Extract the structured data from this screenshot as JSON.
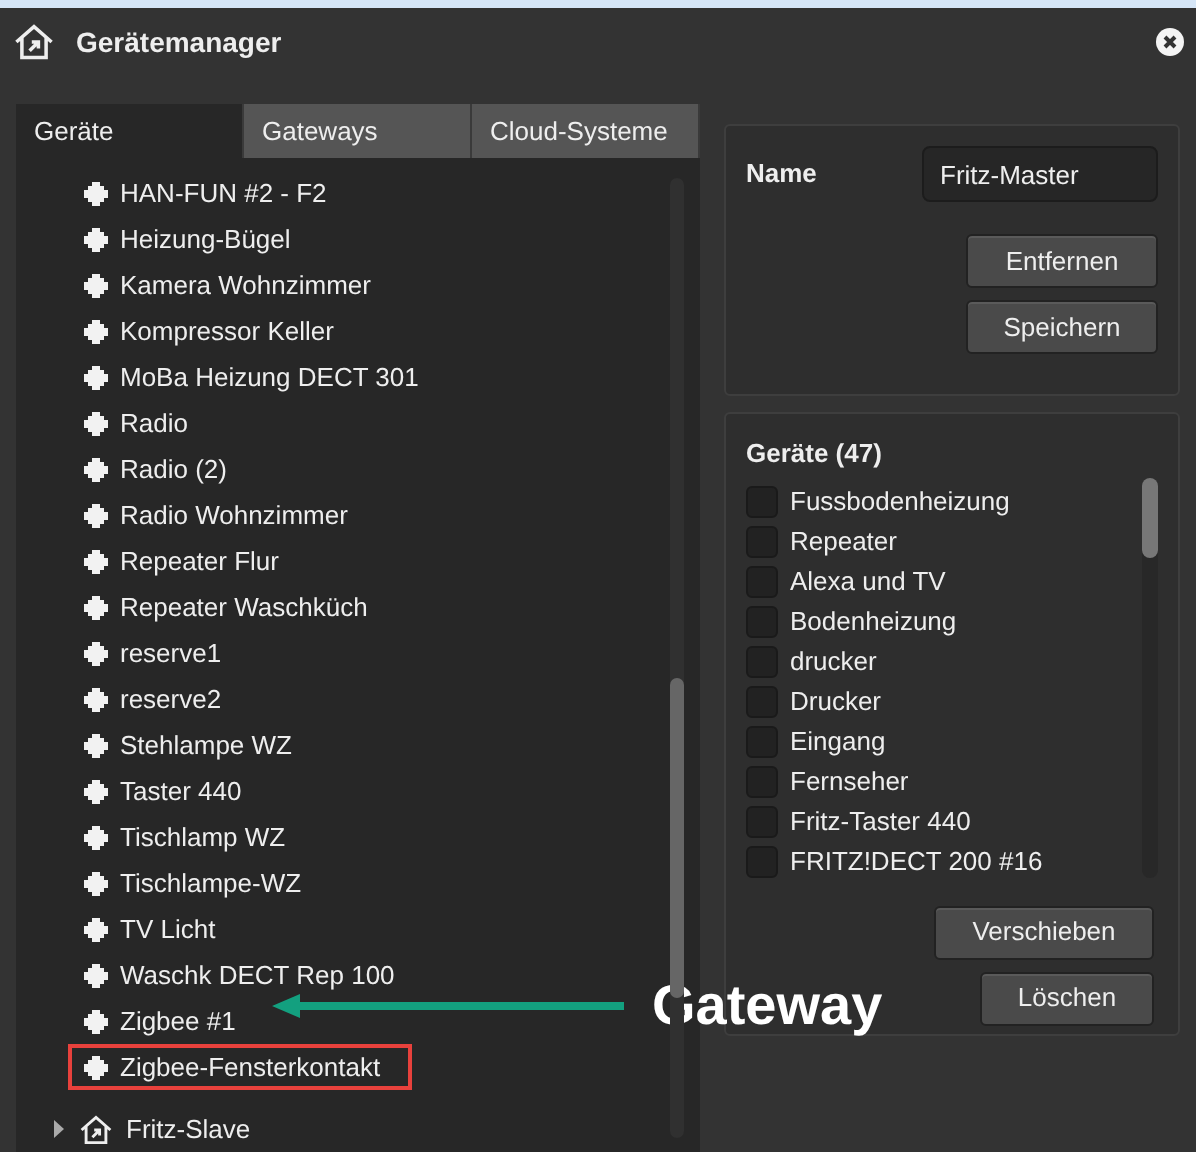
{
  "window": {
    "title": "Gerätemanager"
  },
  "tabs": [
    {
      "label": "Geräte",
      "selected": true
    },
    {
      "label": "Gateways",
      "selected": false
    },
    {
      "label": "Cloud-Systeme",
      "selected": false
    }
  ],
  "tree": [
    {
      "kind": "device",
      "label": "HAN-FUN #2 - F2",
      "highlighted": false
    },
    {
      "kind": "device",
      "label": "Heizung-Bügel",
      "highlighted": false
    },
    {
      "kind": "device",
      "label": "Kamera Wohnzimmer",
      "highlighted": false
    },
    {
      "kind": "device",
      "label": "Kompressor Keller",
      "highlighted": false
    },
    {
      "kind": "device",
      "label": "MoBa Heizung DECT 301",
      "highlighted": false
    },
    {
      "kind": "device",
      "label": "Radio",
      "highlighted": false
    },
    {
      "kind": "device",
      "label": "Radio (2)",
      "highlighted": false
    },
    {
      "kind": "device",
      "label": "Radio Wohnzimmer",
      "highlighted": false
    },
    {
      "kind": "device",
      "label": "Repeater Flur",
      "highlighted": false
    },
    {
      "kind": "device",
      "label": "Repeater Waschküch",
      "highlighted": false
    },
    {
      "kind": "device",
      "label": "reserve1",
      "highlighted": false
    },
    {
      "kind": "device",
      "label": "reserve2",
      "highlighted": false
    },
    {
      "kind": "device",
      "label": "Stehlampe WZ",
      "highlighted": false
    },
    {
      "kind": "device",
      "label": "Taster 440",
      "highlighted": false
    },
    {
      "kind": "device",
      "label": "Tischlamp WZ",
      "highlighted": false
    },
    {
      "kind": "device",
      "label": "Tischlampe-WZ",
      "highlighted": false
    },
    {
      "kind": "device",
      "label": "TV Licht",
      "highlighted": false
    },
    {
      "kind": "device",
      "label": "Waschk DECT Rep 100",
      "highlighted": false
    },
    {
      "kind": "device",
      "label": "Zigbee #1",
      "highlighted": false,
      "callout": "Gateway"
    },
    {
      "kind": "device",
      "label": "Zigbee-Fensterkontakt",
      "highlighted": true
    },
    {
      "kind": "gateway",
      "label": "Fritz-Slave",
      "highlighted": false,
      "expanded": false
    }
  ],
  "details": {
    "name_label": "Name",
    "name_value": "Fritz-Master",
    "buttons": [
      "Entfernen",
      "Speichern"
    ]
  },
  "devices": {
    "title": "Geräte (47)",
    "items": [
      {
        "label": "Fussbodenheizung",
        "checked": false
      },
      {
        "label": "Repeater",
        "checked": false
      },
      {
        "label": "Alexa und TV",
        "checked": false
      },
      {
        "label": "Bodenheizung",
        "checked": false
      },
      {
        "label": "drucker",
        "checked": false
      },
      {
        "label": "Drucker",
        "checked": false
      },
      {
        "label": "Eingang",
        "checked": false
      },
      {
        "label": "Fernseher",
        "checked": false
      },
      {
        "label": "Fritz-Taster 440",
        "checked": false
      },
      {
        "label": "FRITZ!DECT 200 #16",
        "checked": false
      }
    ],
    "buttons": [
      "Verschieben",
      "Löschen"
    ]
  }
}
